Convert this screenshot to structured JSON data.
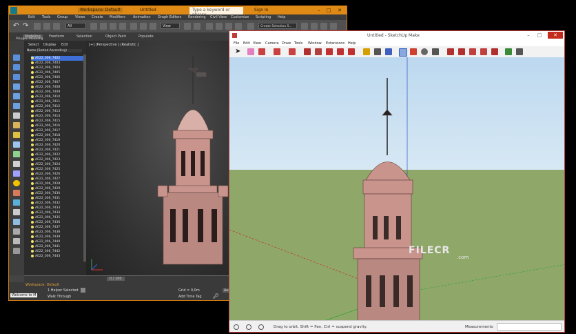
{
  "max": {
    "title": "Untitled",
    "workspace": "Workspace: Default",
    "search_placeholder": "Type a keyword or phrase",
    "signin": "Sign In",
    "menu": [
      "Edit",
      "Tools",
      "Group",
      "Views",
      "Create",
      "Modifiers",
      "Animation",
      "Graph Editors",
      "Rendering",
      "Civil View",
      "Customize",
      "Scripting",
      "Help"
    ],
    "ribbon": [
      "Modeling",
      "Freeform",
      "Selection",
      "Object Paint",
      "Populate"
    ],
    "ribbon_sub": "Polygon Modeling",
    "toolbar_dropdown_all": "All",
    "toolbar_dropdown_view": "View",
    "toolbar_selection_set": "Create Selection S...",
    "scene_tabs": [
      "Select",
      "Display",
      "Edit"
    ],
    "scene_header": "Name (Sorted Ascending)",
    "scene_items": [
      "AE22_006_7402",
      "AE22_006_7403",
      "AE22_006_7404",
      "AE22_006_7405",
      "AE22_006_7406",
      "AE22_006_7407",
      "AE22_006_7408",
      "AE22_006_7409",
      "AE22_006_7410",
      "AE22_006_7411",
      "AE22_006_7412",
      "AE22_006_7413",
      "AE22_006_7414",
      "AE22_006_7415",
      "AE22_006_7416",
      "AE22_006_7417",
      "AE22_006_7418",
      "AE22_006_7419",
      "AE22_006_7420",
      "AE22_006_7421",
      "AE22_006_7422",
      "AE22_006_7423",
      "AE22_006_7424",
      "AE22_006_7425",
      "AE22_006_7426",
      "AE22_006_7427",
      "AE22_006_7428",
      "AE22_006_7429",
      "AE22_006_7430",
      "AE22_006_7431",
      "AE22_006_7432",
      "AE22_006_7433",
      "AE22_006_7434",
      "AE22_006_7435",
      "AE22_006_7436",
      "AE22_006_7437",
      "AE22_006_7438",
      "AE22_006_7439",
      "AE22_006_7440",
      "AE22_006_7441",
      "AE22_006_7442",
      "AE22_006_7443"
    ],
    "viewport_label": "[+] [Perspective ] [Realistic ]",
    "time_slider": "0 / 100",
    "status_workspace": "Workspace: Default",
    "status_selected": "1 Helper Selected",
    "status_grid": "Grid = 0,0m",
    "status_welcome": "Welcome to M",
    "status_walk": "Walk Through",
    "status_add_time_tag": "Add Time Tag",
    "status_auto": "Auto"
  },
  "sketchup": {
    "title": "Untitled - SketchUp Make",
    "menu": [
      "File",
      "Edit",
      "View",
      "Camera",
      "Draw",
      "Tools",
      "Window",
      "Extensions",
      "Help"
    ],
    "status_hint": "Drag to orbit. Shift = Pan, Ctrl = suspend gravity.",
    "measurements_label": "Measurements"
  },
  "watermark": {
    "brand": "FILECR",
    "suffix": ".com"
  },
  "colors": {
    "max_accent": "#e08a16",
    "sku_accent": "#c23b3b",
    "sky": "#c9e0f2",
    "ground": "#8fa86a",
    "tower": "#c9948c"
  }
}
